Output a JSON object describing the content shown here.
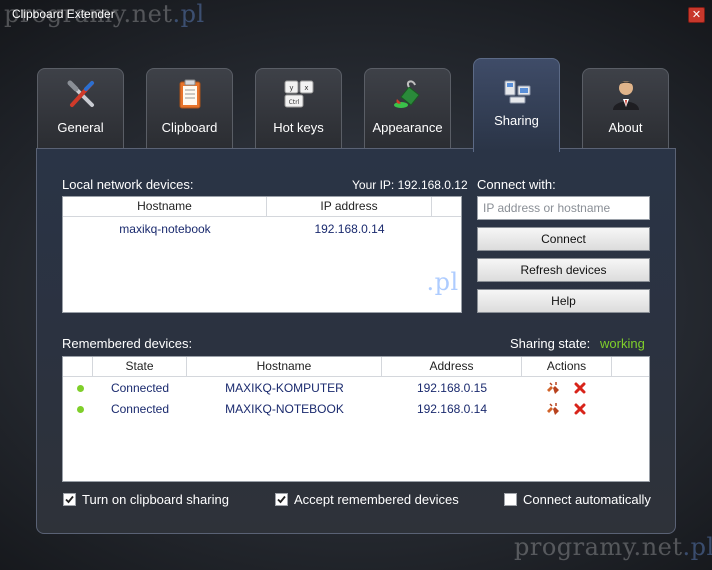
{
  "window": {
    "title": "Clipboard Extender",
    "close_glyph": "✕"
  },
  "watermark": {
    "text": "programy.net",
    "suffix": ".pl"
  },
  "tabs": [
    {
      "label": "General",
      "icon": "tools-icon"
    },
    {
      "label": "Clipboard",
      "icon": "clipboard-icon"
    },
    {
      "label": "Hot keys",
      "icon": "keyboard-keys-icon"
    },
    {
      "label": "Appearance",
      "icon": "paint-bucket-icon"
    },
    {
      "label": "Sharing",
      "icon": "network-computers-icon",
      "active": true
    },
    {
      "label": "About",
      "icon": "user-icon"
    }
  ],
  "local": {
    "heading": "Local network devices:",
    "your_ip": "Your IP: 192.168.0.12",
    "columns": [
      "Hostname",
      "IP address"
    ],
    "rows": [
      {
        "hostname": "maxikq-notebook",
        "ip": "192.168.0.14"
      }
    ]
  },
  "connect": {
    "heading": "Connect with:",
    "placeholder": "IP address or hostname",
    "connect_label": "Connect",
    "refresh_label": "Refresh devices",
    "help_label": "Help"
  },
  "remembered": {
    "heading": "Remembered devices:",
    "sharing_state_label": "Sharing state:",
    "sharing_state_value": "working",
    "columns": [
      "State",
      "Hostname",
      "Address",
      "Actions"
    ],
    "rows": [
      {
        "state": "Connected",
        "hostname": "MAXIKQ-KOMPUTER",
        "address": "192.168.0.15"
      },
      {
        "state": "Connected",
        "hostname": "MAXIKQ-NOTEBOOK",
        "address": "192.168.0.14"
      }
    ]
  },
  "options": {
    "sharing": {
      "label": "Turn on clipboard sharing",
      "checked": true
    },
    "accept": {
      "label": "Accept remembered devices",
      "checked": true
    },
    "auto": {
      "label": "Connect automatically",
      "checked": false
    }
  },
  "colors": {
    "accent_green": "#7fcf2a",
    "link_blue": "#1a2a6e",
    "close_red": "#c8382c"
  }
}
